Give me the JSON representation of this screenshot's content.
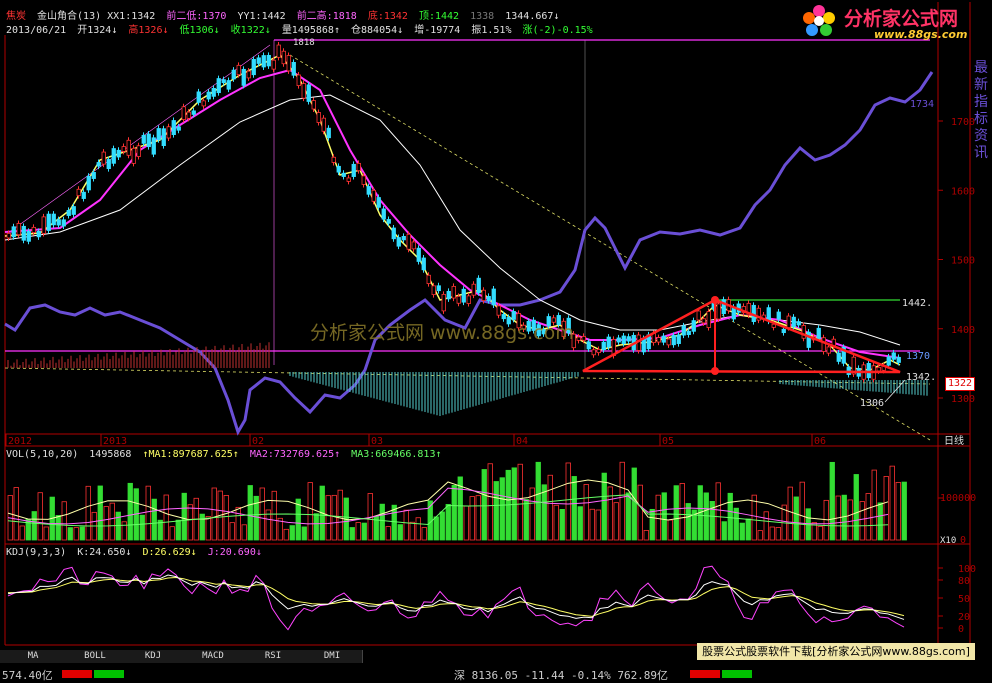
{
  "header": {
    "row1": [
      {
        "text": "焦炭",
        "color": "#ff3333"
      },
      {
        "text": "金山角合(13) XX1:1342",
        "color": "#e0e0e0"
      },
      {
        "text": "前二低:1370",
        "color": "#ff66ff"
      },
      {
        "text": "YY1:1442",
        "color": "#e0e0e0"
      },
      {
        "text": "前二高:1818",
        "color": "#ff66ff"
      },
      {
        "text": "底:1342",
        "color": "#ff3333"
      },
      {
        "text": "顶:1442",
        "color": "#33ff33"
      },
      {
        "text": "1338",
        "color": "#777777"
      },
      {
        "text": "1344.667↓",
        "color": "#e0e0e0"
      }
    ],
    "row2": [
      {
        "text": "2013/06/21",
        "color": "#e0e0e0"
      },
      {
        "text": "开1324↓",
        "color": "#e0e0e0"
      },
      {
        "text": "高1326↓",
        "color": "#ff3333"
      },
      {
        "text": "低1306↓",
        "color": "#33ff33"
      },
      {
        "text": "收1322↓",
        "color": "#33ff33"
      },
      {
        "text": "量1495868↑",
        "color": "#e0e0e0"
      },
      {
        "text": "仓884054↓",
        "color": "#e0e0e0"
      },
      {
        "text": "增-19774",
        "color": "#e0e0e0"
      },
      {
        "text": "振1.51%",
        "color": "#e0e0e0"
      },
      {
        "text": "涨(-2)-0.15%",
        "color": "#33ff33"
      }
    ]
  },
  "logo": {
    "title": "分析家公式网",
    "url": "www.88gs.com"
  },
  "watermark": "分析家公式网 www.88gs.com",
  "price_axis": {
    "ticks": [
      {
        "v": 1700,
        "label": "1700"
      },
      {
        "v": 1600,
        "label": "1600"
      },
      {
        "v": 1500,
        "label": "1500"
      },
      {
        "v": 1400,
        "label": "1400"
      },
      {
        "v": 1300,
        "label": "1300"
      }
    ],
    "current_price": "1322"
  },
  "annotations": {
    "high": "1818",
    "y1": "1442.",
    "x1": "1342.",
    "prev_low": "1370",
    "low": "1306",
    "right_val": "1734"
  },
  "time_axis": {
    "labels": [
      "2012",
      "2013",
      "02",
      "03",
      "04",
      "05",
      "06"
    ],
    "period": "日线"
  },
  "vol_panel": {
    "title": "VOL(5,10,20)",
    "values": [
      {
        "text": "1495868",
        "color": "#e0e0e0"
      },
      {
        "text": "↑MA1:897687.625↑",
        "color": "#ffff66"
      },
      {
        "text": "MA2:732769.625↑",
        "color": "#ff66ff"
      },
      {
        "text": "MA3:669466.813↑",
        "color": "#66ff66"
      }
    ],
    "ticks": [
      "100000",
      "X10",
      "0"
    ]
  },
  "kdj_panel": {
    "title": "KDJ(9,3,3)",
    "values": [
      {
        "text": "K:24.650↓",
        "color": "#e0e0e0"
      },
      {
        "text": "D:26.629↓",
        "color": "#ffff66"
      },
      {
        "text": "J:20.690↓",
        "color": "#ff66ff"
      }
    ],
    "ticks": [
      "100",
      "80",
      "50",
      "20",
      "0"
    ]
  },
  "tabs": [
    "MA",
    "BOLL",
    "KDJ",
    "MACD",
    "RSI",
    "DMI"
  ],
  "download_banner": "股票公式股票软件下载[分析家公式网www.88gs.com]",
  "side_text": "最新指标 资讯",
  "footer": {
    "left": "574.40亿",
    "right": "深 8136.05 -11.44 -0.14% 762.89亿"
  },
  "colors": {
    "up": "#ff3333",
    "down": "#33ff33",
    "ma1": "#ffff66",
    "ma2": "#ff33ff",
    "ma3": "#ffffff",
    "line": "#6a4fd6",
    "axis": "#b00000"
  }
}
